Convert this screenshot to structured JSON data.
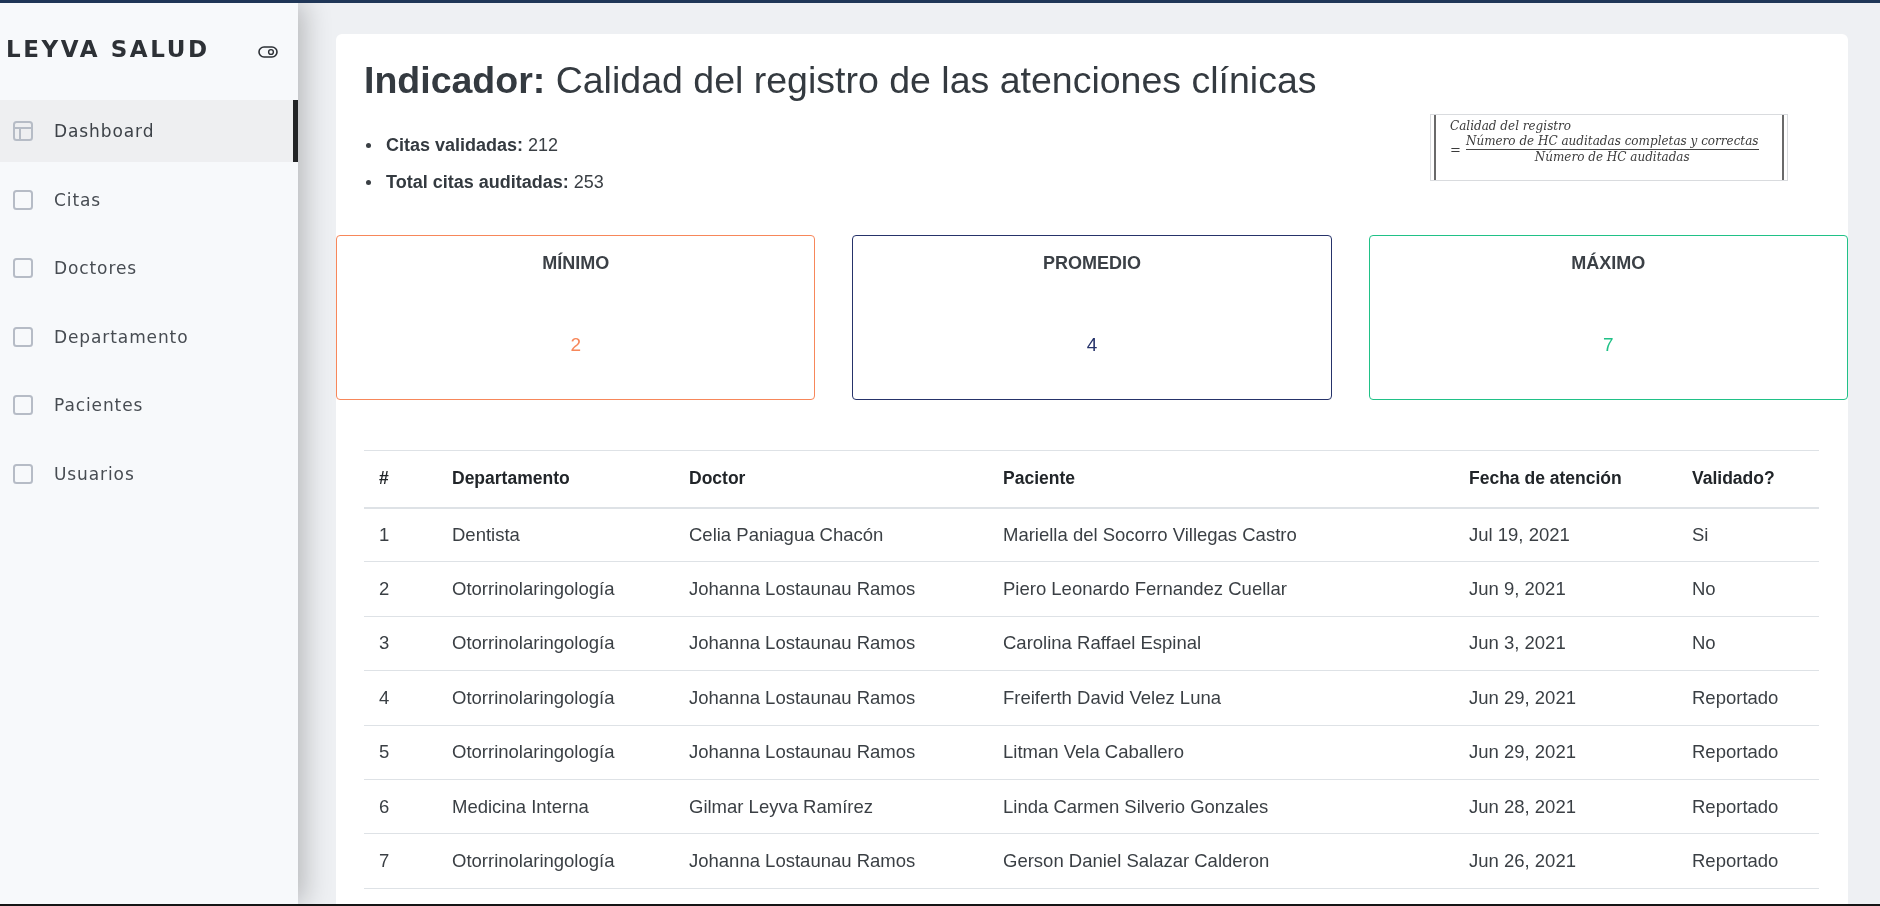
{
  "sidebar": {
    "brand": "LEYVA SALUD",
    "items": [
      {
        "label": "Dashboard",
        "kind": "layout",
        "selected": true
      },
      {
        "label": "Citas",
        "kind": "square",
        "selected": false
      },
      {
        "label": "Doctores",
        "kind": "square",
        "selected": false
      },
      {
        "label": "Departamento",
        "kind": "square",
        "selected": false
      },
      {
        "label": "Pacientes",
        "kind": "square",
        "selected": false
      },
      {
        "label": "Usuarios",
        "kind": "square",
        "selected": false
      }
    ]
  },
  "header": {
    "title": "**Indicador:** Calidad del registro de las atenciones clínicas",
    "stats": [
      "**Citas validadas:** 212",
      "**Total citas auditadas:** 253"
    ]
  },
  "formula": {
    "label": "Calidad del registro",
    "operator": "=",
    "numerator": "Número de HC auditadas completas y correctas",
    "denominator": "Número de HC auditadas"
  },
  "cards": [
    {
      "title": "MÍNIMO",
      "value": "2",
      "color": "#f7875a"
    },
    {
      "title": "PROMEDIO",
      "value": "4",
      "color": "#26336a"
    },
    {
      "title": "MÁXIMO",
      "value": "7",
      "color": "#20c187"
    }
  ],
  "table": {
    "columns": [
      "#",
      "Departamento",
      "Doctor",
      "Paciente",
      "Fecha de atención",
      "Validado?"
    ],
    "rows": [
      [
        "1",
        "Dentista",
        "Celia Paniagua Chacón",
        "Mariella del Socorro Villegas Castro",
        "Jul 19, 2021",
        "Si"
      ],
      [
        "2",
        "Otorrinolaringología",
        "Johanna Lostaunau Ramos",
        "Piero Leonardo Fernandez Cuellar",
        "Jun 9, 2021",
        "No"
      ],
      [
        "3",
        "Otorrinolaringología",
        "Johanna Lostaunau Ramos",
        "Carolina Raffael Espinal",
        "Jun 3, 2021",
        "No"
      ],
      [
        "4",
        "Otorrinolaringología",
        "Johanna Lostaunau Ramos",
        "Freiferth David Velez Luna",
        "Jun 29, 2021",
        "Reportado"
      ],
      [
        "5",
        "Otorrinolaringología",
        "Johanna Lostaunau Ramos",
        "Litman Vela Caballero",
        "Jun 29, 2021",
        "Reportado"
      ],
      [
        "6",
        "Medicina Interna",
        "Gilmar Leyva Ramírez",
        "Linda Carmen Silverio Gonzales",
        "Jun 28, 2021",
        "Reportado"
      ],
      [
        "7",
        "Otorrinolaringología",
        "Johanna Lostaunau Ramos",
        "Gerson Daniel Salazar Calderon",
        "Jun 26, 2021",
        "Reportado"
      ]
    ]
  }
}
